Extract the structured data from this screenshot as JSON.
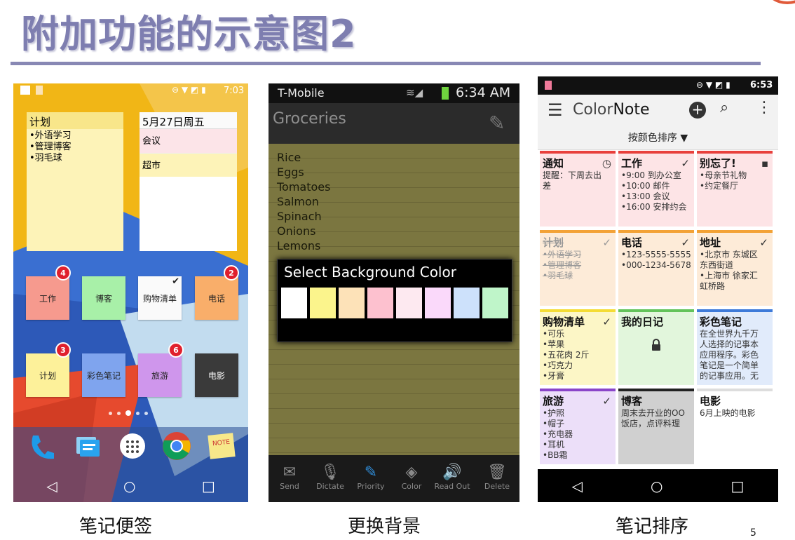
{
  "slide": {
    "title": "附加功能的示意图2",
    "page_number": "5",
    "captions": [
      "笔记便签",
      "更换背景",
      "笔记排序"
    ]
  },
  "phone1": {
    "status_time": "7:03",
    "widget_plan": {
      "title": "计划",
      "items": [
        "•外语学习",
        "•管理博客",
        "•羽毛球"
      ]
    },
    "widget_calendar": {
      "date": "5月27日周五",
      "events": [
        "会议",
        "超市"
      ]
    },
    "note_icons": [
      {
        "label": "工作",
        "badge": "4",
        "color": "#f69a8e"
      },
      {
        "label": "博客",
        "badge": "",
        "color": "#a8f0a8"
      },
      {
        "label": "购物清单",
        "badge": "",
        "color": "#fafafa",
        "checked": true
      },
      {
        "label": "电话",
        "badge": "2",
        "color": "#f9ae6a"
      },
      {
        "label": "计划",
        "badge": "3",
        "color": "#fdf19a"
      },
      {
        "label": "彩色笔记",
        "badge": "",
        "color": "#7fa4ee"
      },
      {
        "label": "旅游",
        "badge": "6",
        "color": "#cf96ec"
      },
      {
        "label": "电影",
        "badge": "",
        "color": "#3a3a3a"
      }
    ],
    "dock_icons": [
      "phone-icon",
      "messages-icon",
      "apps-icon",
      "chrome-icon",
      "note-icon"
    ],
    "dock_note_label": "NOTE",
    "nav": [
      "◁",
      "○",
      "□"
    ]
  },
  "phone2": {
    "carrier": "T-Mobile",
    "status_time": "6:34 AM",
    "note_title": "Groceries",
    "items": [
      "Rice",
      "Eggs",
      "Tomatoes",
      "Salmon",
      "Spinach",
      "Onions",
      "Lemons"
    ],
    "dialog_title": "Select Background Color",
    "swatches": [
      "#ffffff",
      "#fbf48c",
      "#fde2b8",
      "#fdc1cf",
      "#fde9f0",
      "#fad9fa",
      "#cde1fb",
      "#bff5c9"
    ],
    "toolbar": [
      {
        "label": "Send",
        "icon": "✉"
      },
      {
        "label": "Dictate",
        "icon": "🎙"
      },
      {
        "label": "Priority",
        "icon": "✎"
      },
      {
        "label": "Color",
        "icon": "◈"
      },
      {
        "label": "Read Out",
        "icon": "🔊"
      },
      {
        "label": "Delete",
        "icon": "🗑"
      }
    ]
  },
  "phone3": {
    "status_time": "6:53",
    "app_name_prefix": "Color",
    "app_name_suffix": "Note",
    "sort_label": "按颜色排序 ▼",
    "cards": [
      {
        "title": "通知",
        "mark": "◷",
        "body": [
          "提醒：下周去出",
          "差"
        ],
        "bg": "#fde4e6",
        "bar": "#e8403c"
      },
      {
        "title": "工作",
        "mark": "✓",
        "body": [
          "•9:00 到办公室",
          "•10:00 邮件",
          "•13:00 会议",
          "•16:00 安排约会"
        ],
        "bg": "#fde4e6",
        "bar": "#e8403c"
      },
      {
        "title": "别忘了!",
        "mark": "▪",
        "body": [
          "•母亲节礼物",
          "•约定餐厅"
        ],
        "bg": "#fde4e6",
        "bar": "#e8403c"
      },
      {
        "title": "计划",
        "mark": "✓",
        "body": [
          "•外语学习",
          "•管理博客",
          "•羽毛球"
        ],
        "bg": "#fdebd8",
        "bar": "#f3a236",
        "strike": true
      },
      {
        "title": "电话",
        "mark": "✓",
        "body": [
          "•123-5555-5555",
          "•000-1234-5678"
        ],
        "bg": "#fdebd8",
        "bar": "#f3a236"
      },
      {
        "title": "地址",
        "mark": "✓",
        "body": [
          "•北京市 东城区",
          "东西街道",
          "•上海市 徐家汇",
          "虹桥路"
        ],
        "bg": "#fdebd8",
        "bar": "#f3a236"
      },
      {
        "title": "购物清单",
        "mark": "✓",
        "body": [
          "•可乐",
          "•苹果",
          "•五花肉 2斤",
          "•巧克力",
          "•牙膏"
        ],
        "bg": "#fcf6c6",
        "bar": "#f4dc34"
      },
      {
        "title": "我的日记",
        "mark": "",
        "body": [],
        "lock": true,
        "bg": "#e2f6dc",
        "bar": "#63c35a"
      },
      {
        "title": "彩色笔记",
        "mark": "",
        "body": [
          "在全世界九千万",
          "人选择的记事本",
          "应用程序。彩色",
          "笔记是一个简单",
          "的记事应用。无"
        ],
        "bg": "#e1ebfb",
        "bar": "#3d7ad9"
      },
      {
        "title": "旅游",
        "mark": "✓",
        "body": [
          "•护照",
          "•帽子",
          "•充电器",
          "•耳机",
          "•BB霜"
        ],
        "bg": "#ecdff9",
        "bar": "#8a45c9"
      },
      {
        "title": "博客",
        "mark": "",
        "body": [
          "周末去开业的OO",
          "饭店，点评料理"
        ],
        "bg": "#d0d0d0",
        "bar": "#222222"
      },
      {
        "title": "电影",
        "mark": "",
        "body": [
          "6月上映的电影"
        ],
        "bg": "#ffffff",
        "bar": "#dddddd"
      }
    ],
    "nav": [
      "◁",
      "○",
      "□"
    ]
  }
}
